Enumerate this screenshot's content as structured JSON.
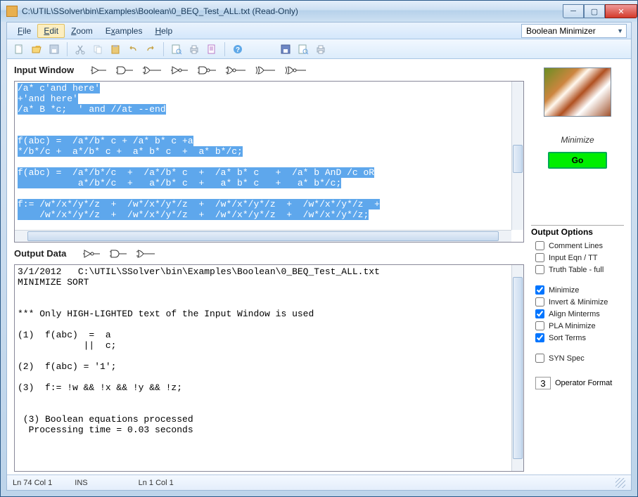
{
  "window": {
    "title": "C:\\UTIL\\SSolver\\bin\\Examples\\Boolean\\0_BEQ_Test_ALL.txt (Read-Only)"
  },
  "menu": {
    "file": "File",
    "edit": "Edit",
    "zoom": "Zoom",
    "examples": "Examples",
    "help": "Help",
    "mode": "Boolean Minimizer"
  },
  "panels": {
    "input_title": "Input Window",
    "output_title": "Output Data"
  },
  "input_text": {
    "l1": "/a* c'and here'",
    "l2": "+'and here'",
    "l3": "/a* B *c;  ' and //at --end",
    "l4": "",
    "l5": "",
    "l6": "f(abc) =  /a*/b* c + /a* b* c +a",
    "l7": "*/b*/c +  a*/b* c +  a* b* c  +  a* b*/c;",
    "l8": "",
    "l9": "f(abc) =  /a*/b*/c  +  /a*/b* c  +  /a* b* c   +  /a* b AnD /c oR",
    "l10": "           a*/b*/c  +   a*/b* c  +   a* b* c   +   a* b*/c;",
    "l11": "",
    "l12": "f:= /w*/x*/y*/z  +  /w*/x*/y*/z  +  /w*/x*/y*/z  +  /w*/x*/y*/z  +",
    "l13": "    /w*/x*/y*/z  +  /w*/x*/y*/z  +  /w*/x*/y*/z  +  /w*/x*/y*/z;"
  },
  "output_text": {
    "l1": "3/1/2012   C:\\UTIL\\SSolver\\bin\\Examples\\Boolean\\0_BEQ_Test_ALL.txt",
    "l2": "MINIMIZE SORT",
    "l3": "",
    "l4": "",
    "l5": "*** Only HIGH-LIGHTED text of the Input Window is used",
    "l6": "",
    "l7": "(1)  f(abc)  =  a",
    "l8": "            ||  c;",
    "l9": "",
    "l10": "(2)  f(abc) = '1';",
    "l11": "",
    "l12": "(3)  f:= !w && !x && !y && !z;",
    "l13": "",
    "l14": "",
    "l15": " (3) Boolean equations processed",
    "l16": "  Processing time = 0.03 seconds"
  },
  "sidebar": {
    "minimize_label": "Minimize",
    "go_label": "Go"
  },
  "options": {
    "title": "Output Options",
    "comment": "Comment Lines",
    "input_eqn": "Input Eqn / TT",
    "truth_table": "Truth Table - full",
    "minimize": "Minimize",
    "invert": "Invert & Minimize",
    "align": "Align Minterms",
    "pla": "PLA Minimize",
    "sort": "Sort Terms",
    "syn": "SYN Spec",
    "op_format_label": "Operator Format",
    "op_format_value": "3"
  },
  "status": {
    "left1": "Ln 74  Col 1",
    "left2": "INS",
    "right1": "Ln 1  Col 1"
  }
}
